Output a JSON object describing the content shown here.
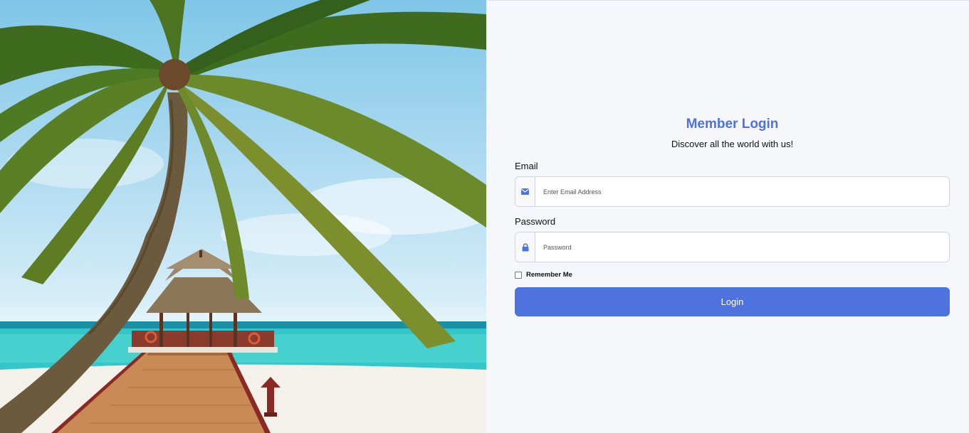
{
  "login": {
    "title": "Member Login",
    "subtitle": "Discover all the world with us!",
    "email_label": "Email",
    "email_placeholder": "Enter Email Address",
    "email_value": "",
    "email_icon": "envelope-icon",
    "password_label": "Password",
    "password_placeholder": "Password",
    "password_value": "",
    "password_icon": "lock-icon",
    "remember_label": "Remember Me",
    "remember_checked": false,
    "login_button": "Login"
  },
  "hero": {
    "image": "tropical-beach-palm-pier-photo"
  },
  "colors": {
    "accent": "#4e73df",
    "panel_background": "#f6f7fb",
    "field_border": "#d1d5db"
  }
}
